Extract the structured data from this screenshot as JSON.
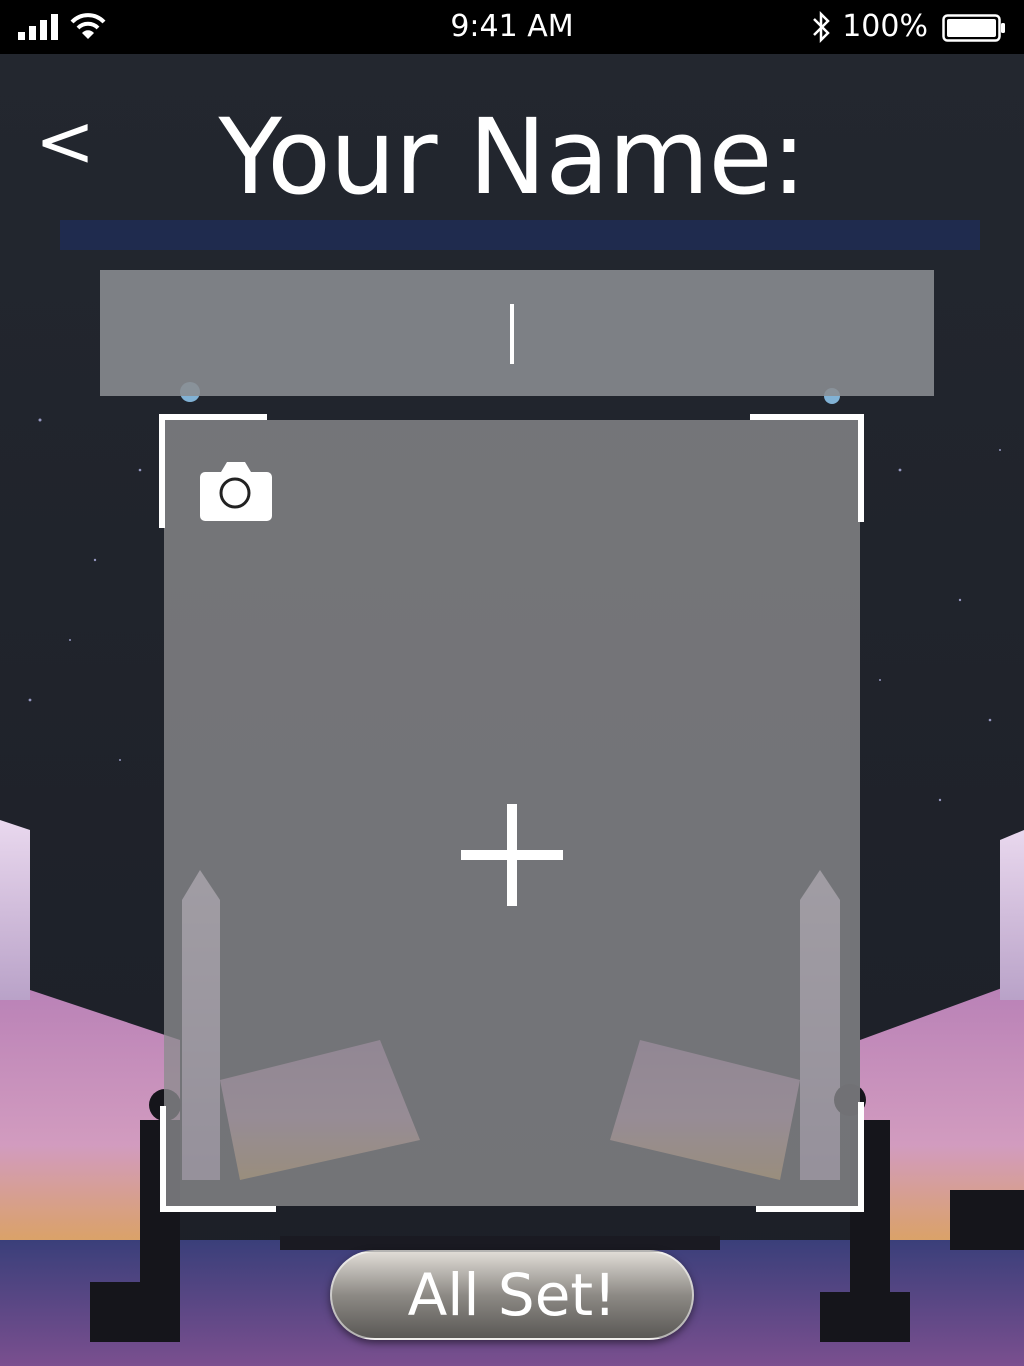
{
  "status_bar": {
    "time": "9:41 AM",
    "battery_percent": "100%",
    "signal_icon": "cellular-signal-icon",
    "wifi_icon": "wifi-icon",
    "bluetooth_icon": "bluetooth-icon",
    "battery_icon": "battery-icon",
    "battery_level": 1.0
  },
  "header": {
    "back_label": "<",
    "title": "Your Name:"
  },
  "name_input": {
    "value": "",
    "placeholder": ""
  },
  "photo_frame": {
    "camera_icon": "camera-icon",
    "add_icon": "plus-icon"
  },
  "footer": {
    "confirm_label": "All Set!"
  },
  "colors": {
    "background": "#22262d",
    "input_fill": "#8a8d92",
    "frame_fill": "#8c8c8e",
    "text": "#ffffff"
  }
}
